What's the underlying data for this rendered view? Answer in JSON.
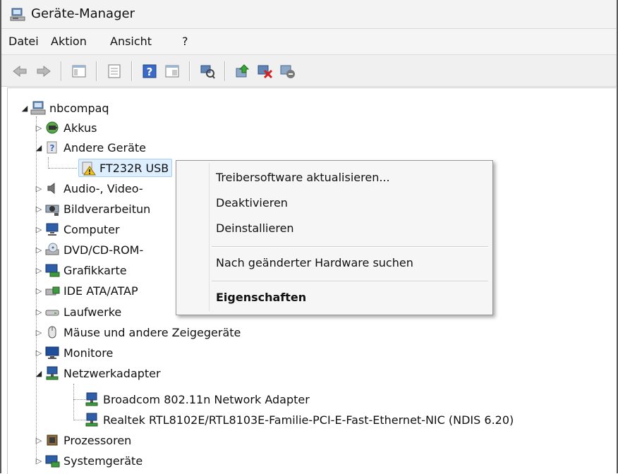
{
  "window": {
    "title": "Geräte-Manager"
  },
  "menu": [
    "Datei",
    "Aktion",
    "Ansicht",
    "?"
  ],
  "toolbar": [
    "back-icon",
    "forward-icon",
    "show-hide-tree-icon",
    "properties-icon",
    "help-icon",
    "view-icon",
    "scan-hardware-icon",
    "update-driver-icon",
    "disable-device-icon",
    "uninstall-device-icon"
  ],
  "tree": {
    "root": "nbcompaq",
    "nodes": [
      {
        "label": "Akkus",
        "icon": "battery-icon",
        "expanded": false
      },
      {
        "label": "Andere Geräte",
        "icon": "unknown-device-icon",
        "expanded": true,
        "children": [
          {
            "label": "FT232R USB",
            "icon": "warning-device-icon",
            "selected": true
          }
        ]
      },
      {
        "label": "Audio-, Video-",
        "icon": "speaker-icon",
        "expanded": false
      },
      {
        "label": "Bildverarbeitun",
        "icon": "camera-icon",
        "expanded": false
      },
      {
        "label": "Computer",
        "icon": "computer-icon",
        "expanded": false
      },
      {
        "label": "DVD/CD-ROM-",
        "icon": "optical-drive-icon",
        "expanded": false
      },
      {
        "label": "Grafikkarte",
        "icon": "display-adapter-icon",
        "expanded": false
      },
      {
        "label": "IDE ATA/ATAP",
        "icon": "ide-controller-icon",
        "expanded": false
      },
      {
        "label": "Laufwerke",
        "icon": "disk-drive-icon",
        "expanded": false
      },
      {
        "label": "Mäuse und andere Zeigegeräte",
        "icon": "mouse-icon",
        "expanded": false
      },
      {
        "label": "Monitore",
        "icon": "monitor-icon",
        "expanded": false
      },
      {
        "label": "Netzwerkadapter",
        "icon": "network-adapter-icon",
        "expanded": true,
        "children": [
          {
            "label": "Broadcom 802.11n Network Adapter",
            "icon": "network-adapter-icon"
          },
          {
            "label": "Realtek RTL8102E/RTL8103E-Familie-PCI-E-Fast-Ethernet-NIC (NDIS 6.20)",
            "icon": "network-adapter-icon"
          }
        ]
      },
      {
        "label": "Prozessoren",
        "icon": "processor-icon",
        "expanded": false
      },
      {
        "label": "Systemgeräte",
        "icon": "system-device-icon",
        "expanded": false
      }
    ]
  },
  "context_menu": {
    "items": [
      {
        "label": "Treibersoftware aktualisieren...",
        "bold": false
      },
      {
        "label": "Deaktivieren",
        "bold": false
      },
      {
        "label": "Deinstallieren",
        "bold": false
      },
      {
        "label": "Nach geänderter Hardware suchen",
        "bold": false
      },
      {
        "label": "Eigenschaften",
        "bold": true
      }
    ]
  }
}
